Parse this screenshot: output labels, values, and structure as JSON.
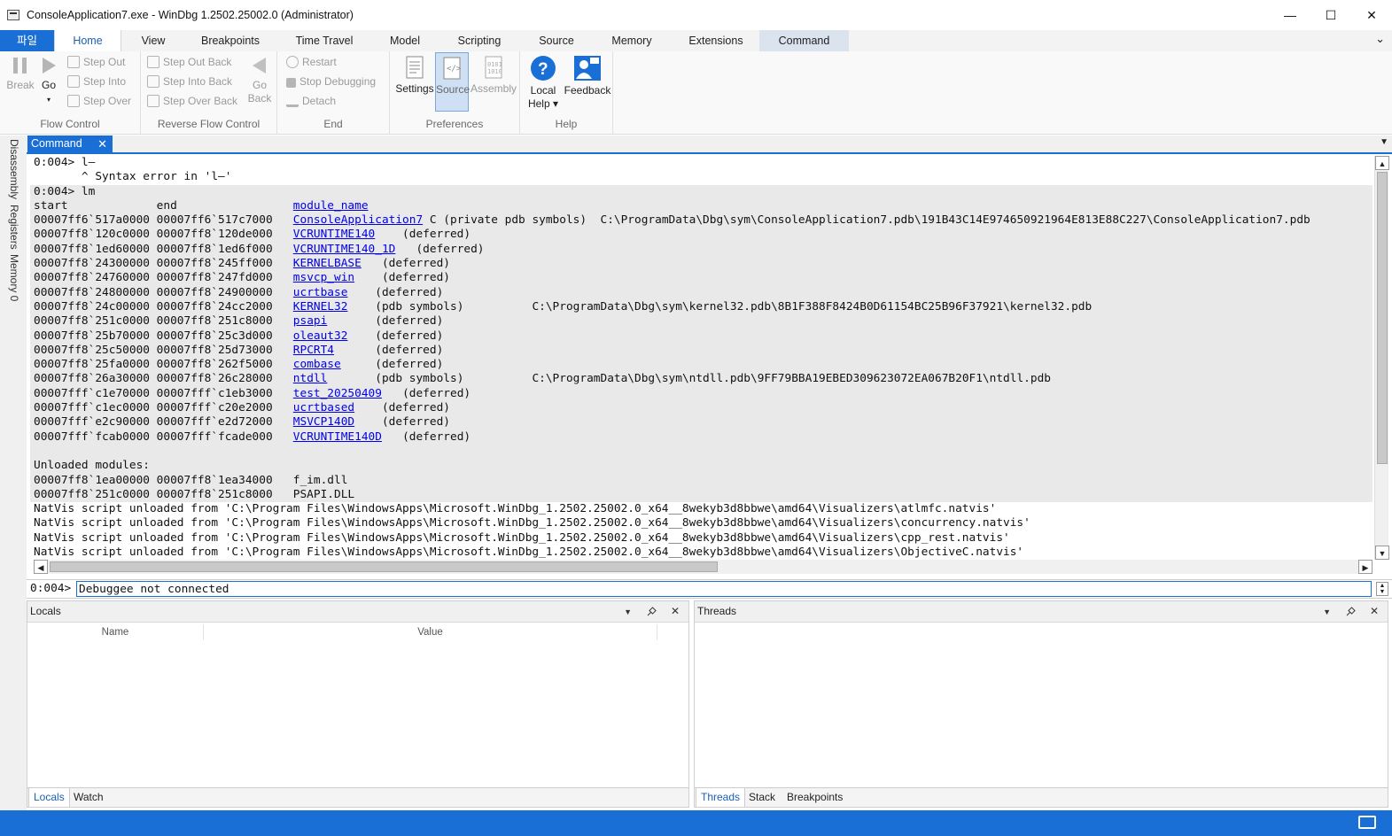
{
  "window": {
    "title": "ConsoleApplication7.exe - WinDbg 1.2502.25002.0 (Administrator)",
    "min_glyph": "—",
    "max_glyph": "☐",
    "close_glyph": "✕"
  },
  "ribbon_tabs": [
    "파일",
    "Home",
    "View",
    "Breakpoints",
    "Time Travel",
    "Model",
    "Scripting",
    "Source",
    "Memory",
    "Extensions",
    "Command"
  ],
  "ribbon_collapse_glyph": "⌄",
  "ribbon": {
    "flow_control": {
      "label": "Flow Control",
      "break": "Break",
      "go": "Go",
      "go_arrow": "▾",
      "step_out": "Step Out",
      "step_into": "Step Into",
      "step_over": "Step Over"
    },
    "reverse_flow_control": {
      "label": "Reverse Flow Control",
      "step_out_back": "Step Out Back",
      "step_into_back": "Step Into Back",
      "step_over_back": "Step Over Back",
      "go_back_1": "Go",
      "go_back_2": "Back"
    },
    "end": {
      "label": "End",
      "restart": "Restart",
      "stop_debugging": "Stop Debugging",
      "detach": "Detach"
    },
    "preferences": {
      "label": "Preferences",
      "settings": "Settings",
      "source": "Source",
      "assembly": "Assembly"
    },
    "help": {
      "label": "Help",
      "local_help_1": "Local",
      "local_help_2": "Help ▾",
      "feedback": "Feedback"
    }
  },
  "left_strip_tabs": [
    "Disassembly",
    "Registers",
    "Memory 0"
  ],
  "command_window": {
    "tab_label": "Command",
    "close_glyph": "✕",
    "menu_glyph": "▼",
    "output_lines": [
      {
        "text": "0:004> l—",
        "shaded": false
      },
      {
        "text": "       ^ Syntax error in 'l—'",
        "shaded": false
      },
      {
        "text": "0:004> lm",
        "shaded": true
      },
      {
        "pre": "start             end                 ",
        "link": "module_name",
        "post": "",
        "shaded": true
      },
      {
        "pre": "00007ff6`517a0000 00007ff6`517c7000   ",
        "link": "ConsoleApplication7",
        "post": " C (private pdb symbols)  C:\\ProgramData\\Dbg\\sym\\ConsoleApplication7.pdb\\191B43C14E974650921964E813E88C227\\ConsoleApplication7.pdb",
        "shaded": true
      },
      {
        "pre": "00007ff8`120c0000 00007ff8`120de000   ",
        "link": "VCRUNTIME140",
        "post": "    (deferred)",
        "shaded": true
      },
      {
        "pre": "00007ff8`1ed60000 00007ff8`1ed6f000   ",
        "link": "VCRUNTIME140_1D",
        "post": "   (deferred)",
        "shaded": true
      },
      {
        "pre": "00007ff8`24300000 00007ff8`245ff000   ",
        "link": "KERNELBASE",
        "post": "   (deferred)",
        "shaded": true
      },
      {
        "pre": "00007ff8`24760000 00007ff8`247fd000   ",
        "link": "msvcp_win",
        "post": "    (deferred)",
        "shaded": true
      },
      {
        "pre": "00007ff8`24800000 00007ff8`24900000   ",
        "link": "ucrtbase",
        "post": "    (deferred)",
        "shaded": true
      },
      {
        "pre": "00007ff8`24c00000 00007ff8`24cc2000   ",
        "link": "KERNEL32",
        "post": "    (pdb symbols)          C:\\ProgramData\\Dbg\\sym\\kernel32.pdb\\8B1F388F8424B0D61154BC25B96F37921\\kernel32.pdb",
        "shaded": true
      },
      {
        "pre": "00007ff8`251c0000 00007ff8`251c8000   ",
        "link": "psapi",
        "post": "       (deferred)",
        "shaded": true
      },
      {
        "pre": "00007ff8`25b70000 00007ff8`25c3d000   ",
        "link": "oleaut32",
        "post": "    (deferred)",
        "shaded": true
      },
      {
        "pre": "00007ff8`25c50000 00007ff8`25d73000   ",
        "link": "RPCRT4",
        "post": "      (deferred)",
        "shaded": true
      },
      {
        "pre": "00007ff8`25fa0000 00007ff8`262f5000   ",
        "link": "combase",
        "post": "     (deferred)",
        "shaded": true
      },
      {
        "pre": "00007ff8`26a30000 00007ff8`26c28000   ",
        "link": "ntdll",
        "post": "       (pdb symbols)          C:\\ProgramData\\Dbg\\sym\\ntdll.pdb\\9FF79BBA19EBED309623072EA067B20F1\\ntdll.pdb",
        "shaded": true
      },
      {
        "pre": "00007fff`c1e70000 00007fff`c1eb3000   ",
        "link": "test_20250409",
        "post": "   (deferred)",
        "shaded": true
      },
      {
        "pre": "00007fff`c1ec0000 00007fff`c20e2000   ",
        "link": "ucrtbased",
        "post": "    (deferred)",
        "shaded": true
      },
      {
        "pre": "00007fff`e2c90000 00007fff`e2d72000   ",
        "link": "MSVCP140D",
        "post": "    (deferred)",
        "shaded": true
      },
      {
        "pre": "00007fff`fcab0000 00007fff`fcade000   ",
        "link": "VCRUNTIME140D",
        "post": "   (deferred)",
        "shaded": true
      },
      {
        "text": " ",
        "shaded": true
      },
      {
        "text": "Unloaded modules:",
        "shaded": true
      },
      {
        "text": "00007ff8`1ea00000 00007ff8`1ea34000   f_im.dll",
        "shaded": true
      },
      {
        "text": "00007ff8`251c0000 00007ff8`251c8000   PSAPI.DLL",
        "shaded": true
      },
      {
        "text": "NatVis script unloaded from 'C:\\Program Files\\WindowsApps\\Microsoft.WinDbg_1.2502.25002.0_x64__8wekyb3d8bbwe\\amd64\\Visualizers\\atlmfc.natvis'",
        "shaded": false
      },
      {
        "text": "NatVis script unloaded from 'C:\\Program Files\\WindowsApps\\Microsoft.WinDbg_1.2502.25002.0_x64__8wekyb3d8bbwe\\amd64\\Visualizers\\concurrency.natvis'",
        "shaded": false
      },
      {
        "text": "NatVis script unloaded from 'C:\\Program Files\\WindowsApps\\Microsoft.WinDbg_1.2502.25002.0_x64__8wekyb3d8bbwe\\amd64\\Visualizers\\cpp_rest.natvis'",
        "shaded": false
      },
      {
        "text": "NatVis script unloaded from 'C:\\Program Files\\WindowsApps\\Microsoft.WinDbg_1.2502.25002.0_x64__8wekyb3d8bbwe\\amd64\\Visualizers\\ObjectiveC.natvis'",
        "shaded": false
      }
    ],
    "prompt": "0:004>",
    "input_value": "Debuggee not connected"
  },
  "locals_panel": {
    "title": "Locals",
    "col_name": "Name",
    "col_value": "Value",
    "footer_tabs": [
      "Locals",
      "Watch"
    ]
  },
  "threads_panel": {
    "title": "Threads",
    "footer_tabs": [
      "Threads",
      "Stack",
      "Breakpoints"
    ]
  },
  "panel_glyphs": {
    "dropdown": "▼",
    "close": "✕"
  },
  "colors": {
    "accent": "#1a6fd6",
    "link": "#0000ee",
    "shaded_bg": "#e9e9e9"
  }
}
